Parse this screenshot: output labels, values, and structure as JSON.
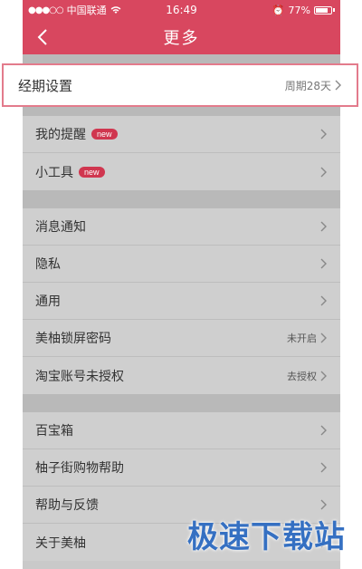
{
  "status": {
    "carrier": "中国联通",
    "time": "16:49",
    "battery": "77%"
  },
  "nav": {
    "title": "更多"
  },
  "highlight": {
    "label": "经期设置",
    "value": "周期28天"
  },
  "section1": [
    {
      "label": "我的提醒",
      "badge": "new"
    },
    {
      "label": "小工具",
      "badge": "new"
    }
  ],
  "section2": [
    {
      "label": "消息通知"
    },
    {
      "label": "隐私"
    },
    {
      "label": "通用"
    },
    {
      "label": "美柚锁屏密码",
      "value": "未开启"
    },
    {
      "label": "淘宝账号未授权",
      "value": "去授权"
    }
  ],
  "section3": [
    {
      "label": "百宝箱"
    },
    {
      "label": "柚子街购物帮助"
    },
    {
      "label": "帮助与反馈"
    },
    {
      "label": "关于美柚"
    }
  ],
  "watermark": "极速下载站",
  "colors": {
    "accent": "#d8475f",
    "badge": "#d0364f",
    "watermark": "#3570c2"
  }
}
